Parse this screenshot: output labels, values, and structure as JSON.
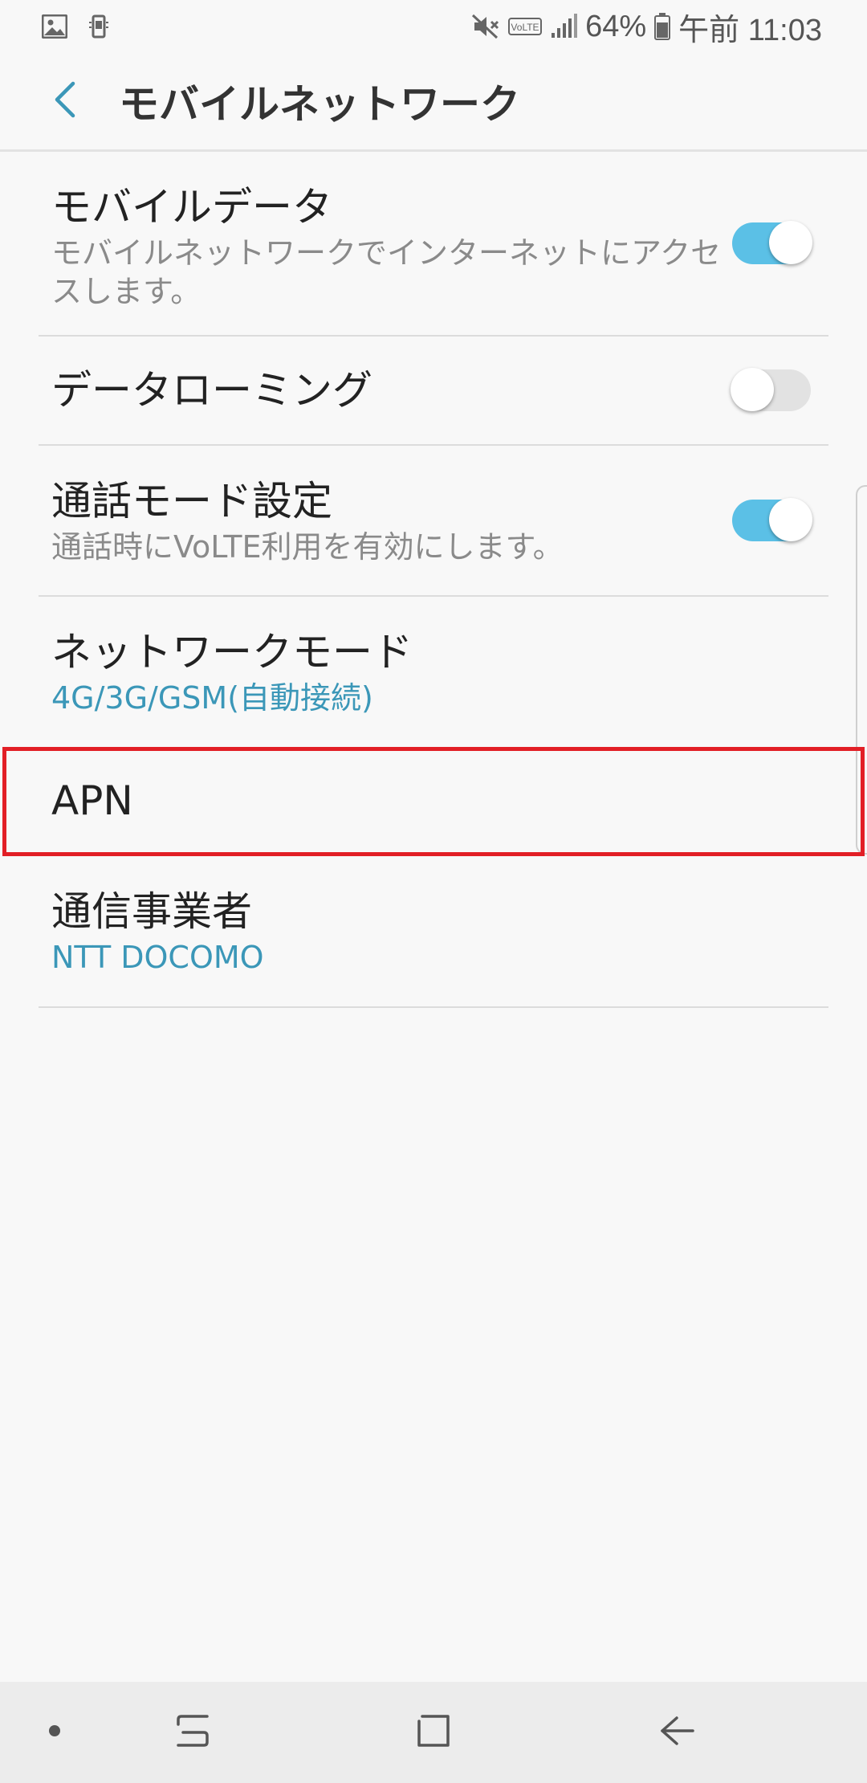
{
  "status_bar": {
    "battery_percent": "64%",
    "time": "午前 11:03",
    "icons": [
      "gallery-icon",
      "screenshot-icon",
      "mute-icon",
      "volte-icon",
      "signal-icon",
      "battery-icon"
    ],
    "volte_label": "VoLTE"
  },
  "app_bar": {
    "title": "モバイルネットワーク",
    "back_icon": "chevron-left-icon"
  },
  "settings": {
    "mobile_data": {
      "label": "モバイルデータ",
      "description_line1": "モバイルネットワークでインターネットにアクセ",
      "description_line2": "スします。",
      "enabled": true
    },
    "data_roaming": {
      "label": "データローミング",
      "enabled": false
    },
    "call_mode": {
      "label": "通話モード設定",
      "description": "通話時にVoLTE利用を有効にします。",
      "enabled": true
    },
    "network_mode": {
      "label": "ネットワークモード",
      "value": "4G/3G/GSM(自動接続)"
    },
    "apn": {
      "label": "APN"
    },
    "carrier": {
      "label": "通信事業者",
      "value": "NTT DOCOMO"
    }
  },
  "colors": {
    "accent": "#3b97b8",
    "switch_on": "#5bc0e6",
    "highlight": "#e21f26"
  },
  "nav_bar": {
    "icons": [
      "dot-icon",
      "recents-icon",
      "home-icon",
      "back-arrow-icon"
    ]
  }
}
